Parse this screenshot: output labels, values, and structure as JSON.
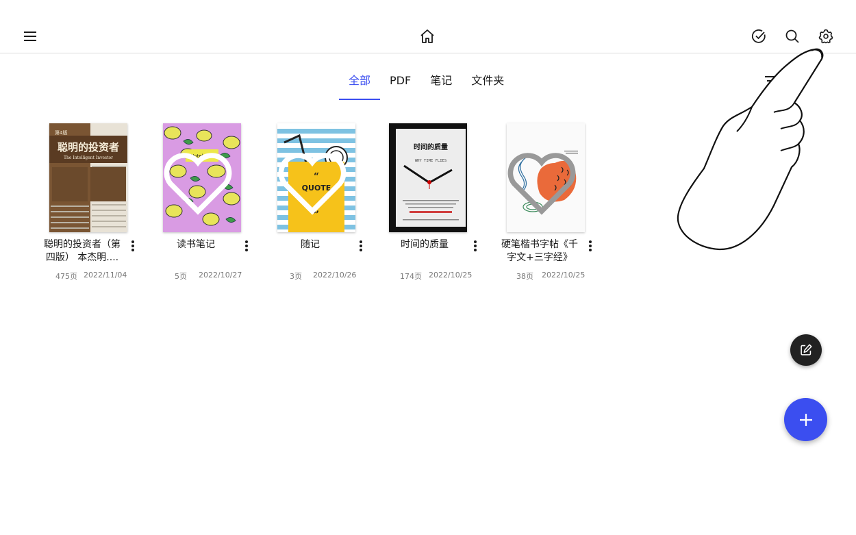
{
  "header": {
    "menu_icon": "menu-icon",
    "home_icon": "home-icon",
    "select_icon": "check-circle-icon",
    "search_icon": "search-icon",
    "settings_icon": "gear-icon"
  },
  "tabs": [
    {
      "label": "全部",
      "active": true
    },
    {
      "label": "PDF",
      "active": false
    },
    {
      "label": "笔记",
      "active": false
    },
    {
      "label": "文件夹",
      "active": false
    }
  ],
  "filter_icon": "filter-icon",
  "books": [
    {
      "title": "聪明的投资者（第四版） 本杰明....",
      "pages": "475页",
      "date": "2022/11/04",
      "cover_text": "聪明的投资者",
      "cover_subtitle": "The Intelligent Investor",
      "cover_edition": "第4版"
    },
    {
      "title": "读书笔记",
      "pages": "5页",
      "date": "2022/10/27",
      "cover_text": "Notebook"
    },
    {
      "title": "随记",
      "pages": "3页",
      "date": "2022/10/26",
      "cover_text": "QUOTE"
    },
    {
      "title": "时间的质量",
      "pages": "174页",
      "date": "2022/10/25",
      "cover_text": "时间的质量",
      "cover_subtitle": "WHY TIME FLIES"
    },
    {
      "title": "硬笔楷书字帖《千字文+三字经》",
      "pages": "38页",
      "date": "2022/10/25"
    }
  ],
  "colors": {
    "accent": "#3b4ef0",
    "edit_fab": "#222222"
  },
  "fab": {
    "edit_icon": "edit-icon",
    "add_icon": "plus-icon"
  }
}
